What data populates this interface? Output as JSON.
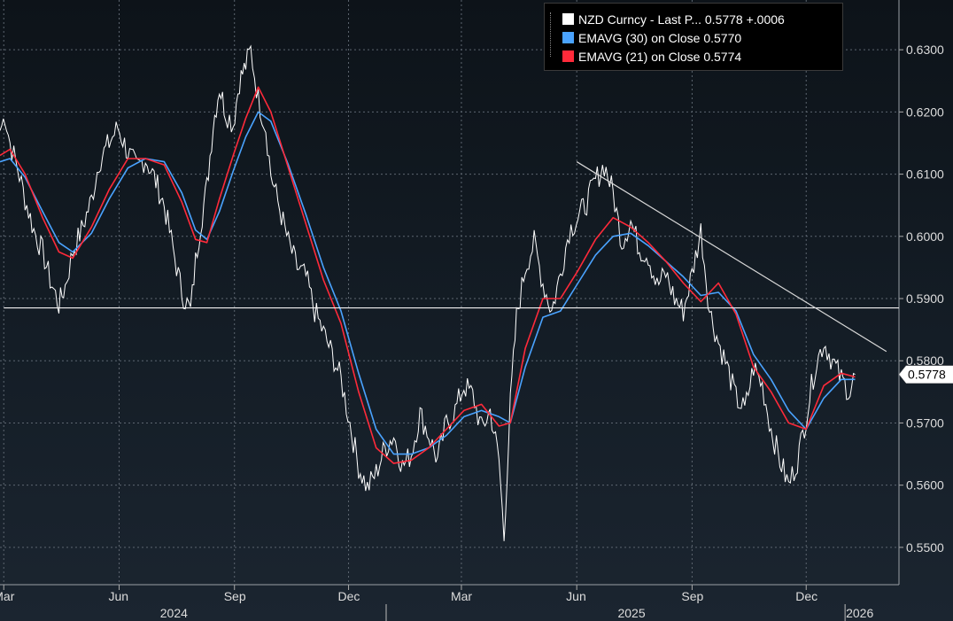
{
  "legend": [
    {
      "text": "NZD Curncy - Last P...  0.5778  +.0006",
      "color": "#ffffff"
    },
    {
      "text": "EMAVG (30)  on Close  0.5770",
      "color": "#4aa3ff"
    },
    {
      "text": "EMAVG (21)  on Close  0.5774",
      "color": "#ff2a3a"
    }
  ],
  "chart_data": {
    "type": "line",
    "title": "",
    "xlabel": "",
    "ylabel": "",
    "ylim": [
      0.544,
      0.638
    ],
    "xlim": [
      "2024-02-27",
      "2026-02-13"
    ],
    "y_ticks": [
      "0.5500",
      "0.5600",
      "0.5700",
      "0.5800",
      "0.5900",
      "0.6000",
      "0.6100",
      "0.6200",
      "0.6300"
    ],
    "x_month_ticks": [
      {
        "date": "2024-03-01",
        "label": "Mar"
      },
      {
        "date": "2024-06-01",
        "label": "Jun"
      },
      {
        "date": "2024-09-01",
        "label": "Sep"
      },
      {
        "date": "2024-12-01",
        "label": "Dec"
      },
      {
        "date": "2025-03-01",
        "label": "Mar"
      },
      {
        "date": "2025-06-01",
        "label": "Jun"
      },
      {
        "date": "2025-09-01",
        "label": "Sep"
      },
      {
        "date": "2025-12-01",
        "label": "Dec"
      }
    ],
    "x_year_labels": [
      {
        "date": "2024-07-15",
        "label": "2024"
      },
      {
        "date": "2025-07-15",
        "label": "2025"
      },
      {
        "date": "2026-01-13",
        "label": "2026"
      }
    ],
    "year_dividers": [
      "2024-12-31",
      "2026-01-01"
    ],
    "last_value_label": "0.5778",
    "grid": true,
    "legend_position": "top-right",
    "series": [
      {
        "name": "NZD Curncy - Last P...",
        "color": "#ffffff",
        "x": [
          "2024-02-27",
          "2024-03-02",
          "2024-03-06",
          "2024-03-12",
          "2024-03-18",
          "2024-03-25",
          "2024-04-01",
          "2024-04-07",
          "2024-04-14",
          "2024-04-19",
          "2024-04-25",
          "2024-05-02",
          "2024-05-10",
          "2024-05-16",
          "2024-05-24",
          "2024-05-31",
          "2024-06-08",
          "2024-06-15",
          "2024-06-22",
          "2024-06-29",
          "2024-07-07",
          "2024-07-14",
          "2024-07-21",
          "2024-07-28",
          "2024-08-01",
          "2024-08-05",
          "2024-08-10",
          "2024-08-15",
          "2024-08-20",
          "2024-08-25",
          "2024-08-31",
          "2024-09-05",
          "2024-09-10",
          "2024-09-14",
          "2024-09-20",
          "2024-09-26",
          "2024-09-30",
          "2024-10-07",
          "2024-10-14",
          "2024-10-21",
          "2024-10-28",
          "2024-11-04",
          "2024-11-11",
          "2024-11-18",
          "2024-11-25",
          "2024-12-02",
          "2024-12-09",
          "2024-12-16",
          "2024-12-23",
          "2024-12-30",
          "2025-01-06",
          "2025-01-13",
          "2025-01-20",
          "2025-01-27",
          "2025-02-03",
          "2025-02-10",
          "2025-02-17",
          "2025-02-24",
          "2025-03-03",
          "2025-03-10",
          "2025-03-17",
          "2025-03-24",
          "2025-03-31",
          "2025-04-04",
          "2025-04-09",
          "2025-04-14",
          "2025-04-21",
          "2025-04-28",
          "2025-05-05",
          "2025-05-12",
          "2025-05-19",
          "2025-05-26",
          "2025-06-02",
          "2025-06-09",
          "2025-06-16",
          "2025-06-23",
          "2025-06-30",
          "2025-07-07",
          "2025-07-14",
          "2025-07-21",
          "2025-07-28",
          "2025-08-04",
          "2025-08-11",
          "2025-08-18",
          "2025-08-25",
          "2025-09-01",
          "2025-09-08",
          "2025-09-15",
          "2025-09-22",
          "2025-09-29",
          "2025-10-06",
          "2025-10-13",
          "2025-10-20",
          "2025-10-27",
          "2025-11-03",
          "2025-11-10",
          "2025-11-17",
          "2025-11-24",
          "2025-12-01",
          "2025-12-08",
          "2025-12-15",
          "2025-12-22",
          "2025-12-29",
          "2026-01-05",
          "2026-01-09"
        ],
        "y": [
          0.617,
          0.6195,
          0.615,
          0.611,
          0.606,
          0.601,
          0.5975,
          0.593,
          0.589,
          0.592,
          0.5975,
          0.601,
          0.606,
          0.612,
          0.615,
          0.6175,
          0.6135,
          0.611,
          0.6125,
          0.6095,
          0.605,
          0.598,
          0.591,
          0.588,
          0.596,
          0.602,
          0.608,
          0.618,
          0.624,
          0.62,
          0.618,
          0.625,
          0.6275,
          0.63,
          0.622,
          0.6175,
          0.61,
          0.6045,
          0.599,
          0.595,
          0.5935,
          0.588,
          0.5845,
          0.581,
          0.577,
          0.57,
          0.563,
          0.5595,
          0.562,
          0.566,
          0.568,
          0.563,
          0.565,
          0.5715,
          0.568,
          0.564,
          0.57,
          0.572,
          0.576,
          0.5745,
          0.569,
          0.572,
          0.564,
          0.5515,
          0.573,
          0.587,
          0.595,
          0.599,
          0.5925,
          0.588,
          0.594,
          0.601,
          0.603,
          0.6055,
          0.609,
          0.6115,
          0.607,
          0.599,
          0.6025,
          0.598,
          0.597,
          0.592,
          0.594,
          0.59,
          0.588,
          0.594,
          0.601,
          0.588,
          0.583,
          0.579,
          0.574,
          0.572,
          0.579,
          0.576,
          0.569,
          0.564,
          0.56,
          0.564,
          0.571,
          0.579,
          0.583,
          0.58,
          0.577,
          0.575,
          0.5778
        ]
      },
      {
        "name": "EMAVG (30)  on Close",
        "color": "#4aa3ff",
        "x": [
          "2024-02-27",
          "2024-03-06",
          "2024-03-18",
          "2024-04-01",
          "2024-04-14",
          "2024-04-25",
          "2024-05-10",
          "2024-05-24",
          "2024-06-08",
          "2024-06-22",
          "2024-07-07",
          "2024-07-21",
          "2024-08-01",
          "2024-08-10",
          "2024-08-20",
          "2024-08-31",
          "2024-09-10",
          "2024-09-20",
          "2024-09-30",
          "2024-10-14",
          "2024-10-28",
          "2024-11-11",
          "2024-11-25",
          "2024-12-09",
          "2024-12-23",
          "2025-01-06",
          "2025-01-20",
          "2025-02-03",
          "2025-02-17",
          "2025-03-03",
          "2025-03-17",
          "2025-03-31",
          "2025-04-09",
          "2025-04-21",
          "2025-05-05",
          "2025-05-19",
          "2025-06-02",
          "2025-06-16",
          "2025-06-30",
          "2025-07-14",
          "2025-07-28",
          "2025-08-11",
          "2025-08-25",
          "2025-09-08",
          "2025-09-22",
          "2025-10-06",
          "2025-10-20",
          "2025-11-03",
          "2025-11-17",
          "2025-12-01",
          "2025-12-15",
          "2025-12-29",
          "2026-01-09"
        ],
        "y": [
          0.612,
          0.6125,
          0.6095,
          0.604,
          0.599,
          0.5975,
          0.6005,
          0.606,
          0.611,
          0.6125,
          0.612,
          0.607,
          0.601,
          0.5995,
          0.604,
          0.6105,
          0.616,
          0.62,
          0.6185,
          0.6115,
          0.6035,
          0.595,
          0.588,
          0.578,
          0.569,
          0.565,
          0.565,
          0.566,
          0.568,
          0.571,
          0.572,
          0.571,
          0.57,
          0.579,
          0.587,
          0.588,
          0.5925,
          0.597,
          0.6,
          0.6005,
          0.5985,
          0.596,
          0.5935,
          0.5905,
          0.591,
          0.588,
          0.581,
          0.577,
          0.572,
          0.569,
          0.574,
          0.577,
          0.577
        ]
      },
      {
        "name": "EMAVG (21)  on Close",
        "color": "#ff2a3a",
        "x": [
          "2024-02-27",
          "2024-03-06",
          "2024-03-18",
          "2024-04-01",
          "2024-04-14",
          "2024-04-25",
          "2024-05-10",
          "2024-05-24",
          "2024-06-08",
          "2024-06-22",
          "2024-07-07",
          "2024-07-21",
          "2024-08-01",
          "2024-08-10",
          "2024-08-20",
          "2024-08-31",
          "2024-09-10",
          "2024-09-20",
          "2024-09-30",
          "2024-10-14",
          "2024-10-28",
          "2024-11-11",
          "2024-11-25",
          "2024-12-09",
          "2024-12-23",
          "2025-01-06",
          "2025-01-20",
          "2025-02-03",
          "2025-02-17",
          "2025-03-03",
          "2025-03-17",
          "2025-03-31",
          "2025-04-09",
          "2025-04-21",
          "2025-05-05",
          "2025-05-19",
          "2025-06-02",
          "2025-06-16",
          "2025-06-30",
          "2025-07-14",
          "2025-07-28",
          "2025-08-11",
          "2025-08-25",
          "2025-09-08",
          "2025-09-22",
          "2025-10-06",
          "2025-10-20",
          "2025-11-03",
          "2025-11-17",
          "2025-12-01",
          "2025-12-15",
          "2025-12-29",
          "2026-01-09"
        ],
        "y": [
          0.613,
          0.614,
          0.61,
          0.603,
          0.5975,
          0.5965,
          0.6015,
          0.6075,
          0.6125,
          0.6125,
          0.6115,
          0.6055,
          0.5995,
          0.599,
          0.606,
          0.613,
          0.619,
          0.624,
          0.62,
          0.611,
          0.602,
          0.593,
          0.586,
          0.575,
          0.566,
          0.5635,
          0.564,
          0.566,
          0.569,
          0.572,
          0.573,
          0.5695,
          0.57,
          0.582,
          0.59,
          0.59,
          0.5945,
          0.5995,
          0.603,
          0.6015,
          0.599,
          0.596,
          0.5925,
          0.5895,
          0.5925,
          0.5875,
          0.579,
          0.575,
          0.57,
          0.569,
          0.576,
          0.578,
          0.5774
        ]
      }
    ],
    "annotations": [
      {
        "type": "horizontal-line",
        "y": 0.5885,
        "x_from": "2024-03-01",
        "x_to": "2026-02-13"
      },
      {
        "type": "trendline",
        "from": {
          "x": "2025-06-01",
          "y": 0.612
        },
        "to": {
          "x": "2026-02-03",
          "y": 0.5815
        }
      }
    ]
  }
}
